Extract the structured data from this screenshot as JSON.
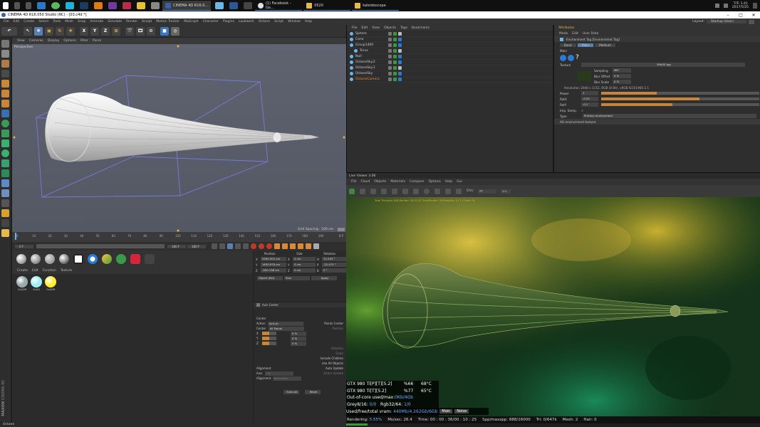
{
  "taskbar": {
    "tasks": [
      {
        "label": "CINEMA 4D R16.0...",
        "color": "#3b5fa0"
      },
      {
        "label": "(1) Facebook - Go...",
        "color": "#e0e0e0"
      },
      {
        "label": "0520",
        "color": "#e7b84a"
      },
      {
        "label": "kaleidoscope",
        "color": "#e7b84a"
      }
    ],
    "clock_time": "下午 1:41",
    "clock_date": "2017/5/25"
  },
  "window": {
    "title": "CINEMA 4D R16.050 Studio (RC) - [03.c4d *]",
    "layout_label": "Layout:",
    "layout_value": "Startup (User)"
  },
  "menu": [
    "File",
    "Edit",
    "Create",
    "Select",
    "Tools",
    "Mesh",
    "Snap",
    "Animate",
    "Simulate",
    "Render",
    "Sculpt",
    "Motion Tracker",
    "MoGraph",
    "Character",
    "Plugins",
    "Laubwerk",
    "Octane",
    "Script",
    "Window",
    "Help"
  ],
  "toolbar_xyz": [
    "X",
    "Y",
    "Z"
  ],
  "viewport": {
    "menu": [
      "View",
      "Cameras",
      "Display",
      "Options",
      "Filter",
      "Panel"
    ],
    "label": "Perspective",
    "grid_spacing": "Grid Spacing : 100 cm"
  },
  "timeline": {
    "ticks": [
      "0",
      "10",
      "20",
      "30",
      "40",
      "50",
      "60",
      "70",
      "80",
      "90",
      "100",
      "110",
      "120",
      "130",
      "140",
      "150",
      "160",
      "170",
      "180",
      "190"
    ],
    "current_frame": "0 F",
    "start": "0 F",
    "end": "180 F",
    "end2": "180 F"
  },
  "material_manager": {
    "menu": [
      "Create",
      "Edit",
      "Function",
      "Texture"
    ],
    "materials": [
      {
        "name": "OctDiff",
        "color": "#9aa"
      },
      {
        "name": "OctGl",
        "color": "#9ef0f8"
      },
      {
        "name": "OctDiff",
        "color": "#ffee33"
      }
    ]
  },
  "coordinates": {
    "headers": [
      "Position",
      "Size",
      "Rotation"
    ],
    "rows": [
      {
        "axis": "X",
        "pos": "2990.502 cm",
        "size": "0 cm",
        "rot_axis": "H",
        "rot": "72.293 °"
      },
      {
        "axis": "Y",
        "pos": "1630.976 cm",
        "size": "0 cm",
        "rot_axis": "P",
        "rot": "-21.471 °"
      },
      {
        "axis": "Z",
        "pos": "-950.198 cm",
        "size": "0 cm",
        "rot_axis": "B",
        "rot": "0 °"
      }
    ],
    "mode": "Object (Rel)",
    "size_mode": "Size",
    "apply": "Apply"
  },
  "axis_center": {
    "title": "Axis Center",
    "center_label": "Center",
    "action_label": "Action",
    "action_value": "Axis to",
    "center_field_label": "Center",
    "center_field_value": "All Points",
    "points_center": "Points Center",
    "position": "Position",
    "rotation": "Rotation",
    "scale": "Scale",
    "include_children": "Include Children",
    "use_all_objects": "Use All Objects",
    "xyz": [
      {
        "axis": "X",
        "value": "0 %",
        "level": 0.5
      },
      {
        "axis": "Y",
        "value": "0 %",
        "level": 0.5
      },
      {
        "axis": "Z",
        "value": "0 %",
        "level": 0.5
      }
    ],
    "alignment_label": "Alignment",
    "axis_label": "Axis",
    "axis_value": "Off",
    "alignment_field_label": "Alignment",
    "alignment_value": "Normalize",
    "auto_update": "Auto Update",
    "editor_update": "Editor Update",
    "execute": "Execute",
    "reset": "Reset"
  },
  "object_manager": {
    "menu": [
      "File",
      "Edit",
      "View",
      "Objects",
      "Tags",
      "Bookmarks"
    ],
    "objects": [
      {
        "name": "Sphere",
        "indent": 0,
        "color": "#ccc"
      },
      {
        "name": "Cone",
        "indent": 0,
        "color": "#ccc"
      },
      {
        "name": "Group1400",
        "indent": 0,
        "color": "#ccc"
      },
      {
        "name": "Torus",
        "indent": 1,
        "color": "#ccc"
      },
      {
        "name": "Null",
        "indent": 0,
        "color": "#ccc"
      },
      {
        "name": "OctaneSky.2",
        "indent": 0,
        "color": "#ccc"
      },
      {
        "name": "OctaneSky.1",
        "indent": 0,
        "color": "#ccc"
      },
      {
        "name": "OctaneSky",
        "indent": 0,
        "color": "#ccc"
      },
      {
        "name": "OctaneCamera",
        "indent": 0,
        "color": "#e88a3a"
      }
    ]
  },
  "attribute_manager": {
    "header": "Attributes",
    "menu": [
      "Mode",
      "Edit",
      "User Data"
    ],
    "tag_title": "Environment Tag [Environment Tag]",
    "tabs": [
      "Basic",
      "Main",
      "Medium"
    ],
    "active_tab": "Main",
    "section": "Main",
    "texture_label": "Texture",
    "texture_value": "IMAGE.jpg",
    "sampling_label": "Sampling",
    "sampling_value": "MIP",
    "blur_offset_label": "Blur Offset",
    "blur_offset_value": "0 %",
    "blur_scale_label": "Blur Scale",
    "blur_scale_value": "0 %",
    "resolution": "Resolution 2048 x 1152, RGB (8 Bit), sRGB IEC61966-2.1",
    "sliders": [
      {
        "label": "Power",
        "value": "1",
        "fill": 0.35
      },
      {
        "label": "RotX",
        "value": "-0.25",
        "fill": 0.62
      },
      {
        "label": "RotY",
        "value": "-0.1",
        "fill": 0.45
      }
    ],
    "imp_samp_label": "Imp. Samp.",
    "type_label": "Type",
    "type_value": "Primary environment",
    "ao_label": "AO environment texture"
  },
  "live_viewer": {
    "title": "Live Viewer 3.06",
    "menu": [
      "File",
      "Cloud",
      "Objects",
      "Materials",
      "Compare",
      "Options",
      "Help",
      "Gui"
    ],
    "chan_label": "Chn:",
    "chan_value": "PT",
    "chan_num": "0.1",
    "header_status": "Total Triangles: 888 Render: 00:10:25 Time/Render: 59/Samples: 0 / 2 / Fixed: 0k",
    "stats": [
      {
        "label": "GTX 980 Ti[P][T][5.2]",
        "pct": "%66",
        "temp": "68°C"
      },
      {
        "label": "GTX 980 Ti[T][5.2]",
        "pct": "%77",
        "temp": "65°C"
      }
    ],
    "out_of_core_label": "Out-of-core used/max:",
    "out_of_core_value": "0Kb/4Gb",
    "grey_label": "Grey8/16:",
    "grey_value": "0/0",
    "rgb_label": "Rgb32/64:",
    "rgb_value": "1/0",
    "vram_label": "Used/free/total vram:",
    "vram_value": "440Mb/4.262Gb/6Gb",
    "tab_main": "Main",
    "tab_noise": "Noise",
    "rendering_label": "Rendering:",
    "rendering_value": "5.55%",
    "ms_label": "Ms/sec:",
    "ms_value": "26.4",
    "time_label": "Time:",
    "time_value": "00 : 00 : 36/00 : 10 : 25",
    "spp_label": "Spp/maxspp:",
    "spp_value": "888/16000",
    "tri_label": "Tri:",
    "tri_value": "0/647k",
    "mesh_label": "Mesh:",
    "mesh_value": "2",
    "hair_label": "Hair:",
    "hair_value": "0"
  },
  "footer": {
    "label": "Octane"
  },
  "brand": {
    "maxon": "MAXON",
    "c4d": "CINEMA 4D"
  }
}
